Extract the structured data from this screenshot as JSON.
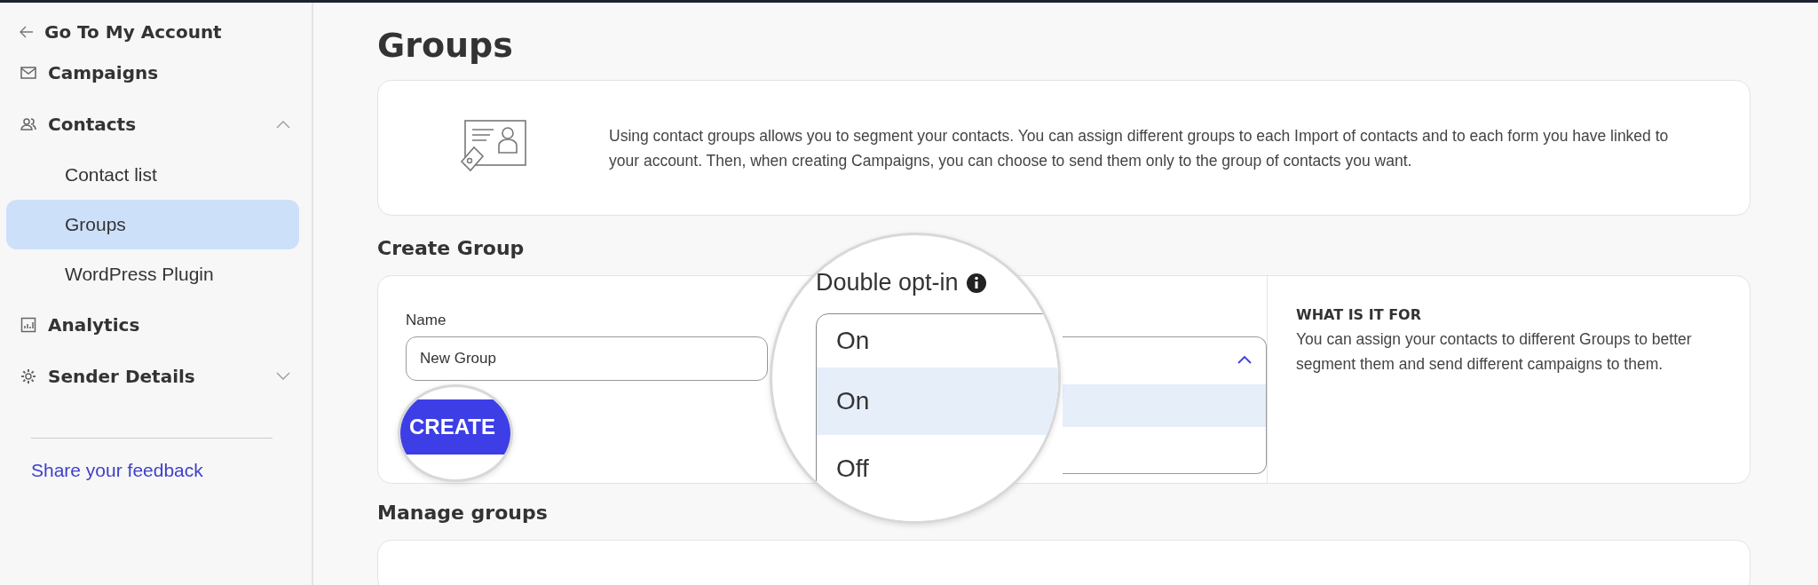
{
  "sidebar": {
    "back_link": "Go To My Account",
    "items": [
      {
        "label": "Campaigns"
      },
      {
        "label": "Contacts",
        "expanded": true,
        "children": [
          {
            "label": "Contact list",
            "selected": false
          },
          {
            "label": "Groups",
            "selected": true
          },
          {
            "label": "WordPress Plugin",
            "selected": false
          }
        ]
      },
      {
        "label": "Analytics"
      },
      {
        "label": "Sender Details",
        "expanded": false
      }
    ],
    "feedback_link": "Share your feedback"
  },
  "page": {
    "title": "Groups",
    "intro": "Using contact groups allows you to segment your contacts. You can assign different groups to each Import of contacts and to each form you have linked to your account. Then, when creating Campaigns, you can choose to send them only to the group of contacts you want.",
    "create_group": {
      "heading": "Create Group",
      "name_field": {
        "label": "Name",
        "value": "New Group"
      },
      "double_opt_in": {
        "label": "Double opt-in",
        "expanded": true,
        "value": "On",
        "options": [
          {
            "label": "On",
            "selected": true
          },
          {
            "label": "Off",
            "selected": false
          }
        ]
      },
      "create_button": "CREATE",
      "help": {
        "title": "WHAT IS IT FOR",
        "text": "You can assign your contacts to different Groups to better segment them and send different campaigns to them."
      }
    },
    "manage_groups": {
      "heading": "Manage groups"
    }
  }
}
